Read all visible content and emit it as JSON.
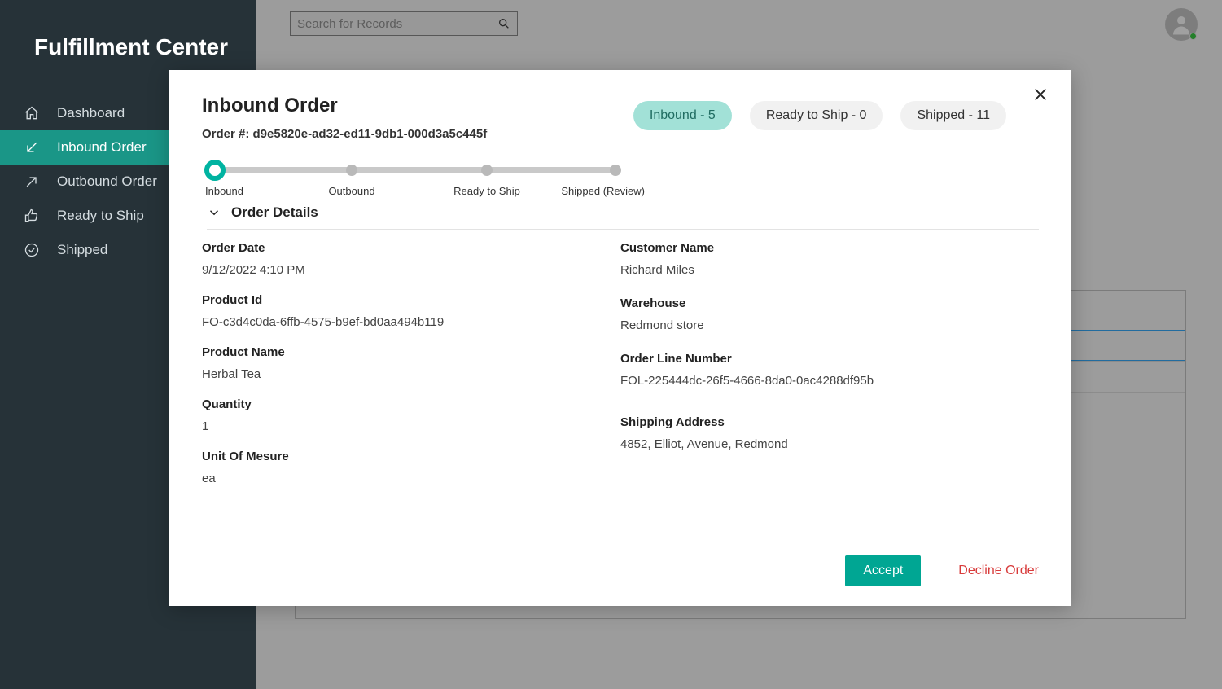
{
  "app": {
    "title": "Fulfillment Center"
  },
  "search": {
    "placeholder": "Search for Records"
  },
  "sidebar": {
    "items": [
      {
        "label": "Dashboard"
      },
      {
        "label": "Inbound Order"
      },
      {
        "label": "Outbound Order"
      },
      {
        "label": "Ready to Ship"
      },
      {
        "label": "Shipped"
      }
    ]
  },
  "modal": {
    "title": "Inbound Order",
    "order_label": "Order #: d9e5820e-ad32-ed11-9db1-000d3a5c445f",
    "pills": [
      {
        "label": "Inbound - 5"
      },
      {
        "label": "Ready to Ship - 0"
      },
      {
        "label": "Shipped - 11"
      }
    ],
    "progress": [
      {
        "label": "Inbound"
      },
      {
        "label": "Outbound"
      },
      {
        "label": "Ready to Ship"
      },
      {
        "label": "Shipped (Review)"
      }
    ],
    "section_title": "Order Details",
    "left": {
      "order_date": {
        "label": "Order Date",
        "value": "9/12/2022 4:10 PM"
      },
      "product_id": {
        "label": "Product Id",
        "value": "FO-c3d4c0da-6ffb-4575-b9ef-bd0aa494b119"
      },
      "product_name": {
        "label": "Product Name",
        "value": "Herbal Tea"
      },
      "quantity": {
        "label": "Quantity",
        "value": "1"
      },
      "uom": {
        "label": "Unit Of Mesure",
        "value": "ea"
      }
    },
    "right": {
      "customer_name": {
        "label": "Customer Name",
        "value": "Richard Miles"
      },
      "warehouse": {
        "label": "Warehouse",
        "value": "Redmond store"
      },
      "order_line_number": {
        "label": "Order Line Number",
        "value": "FOL-225444dc-26f5-4666-8da0-0ac4288df95b"
      },
      "shipping_address": {
        "label": "Shipping Address",
        "value": "4852, Elliot, Avenue, Redmond"
      }
    },
    "buttons": {
      "accept": "Accept",
      "decline": "Decline Order"
    }
  }
}
